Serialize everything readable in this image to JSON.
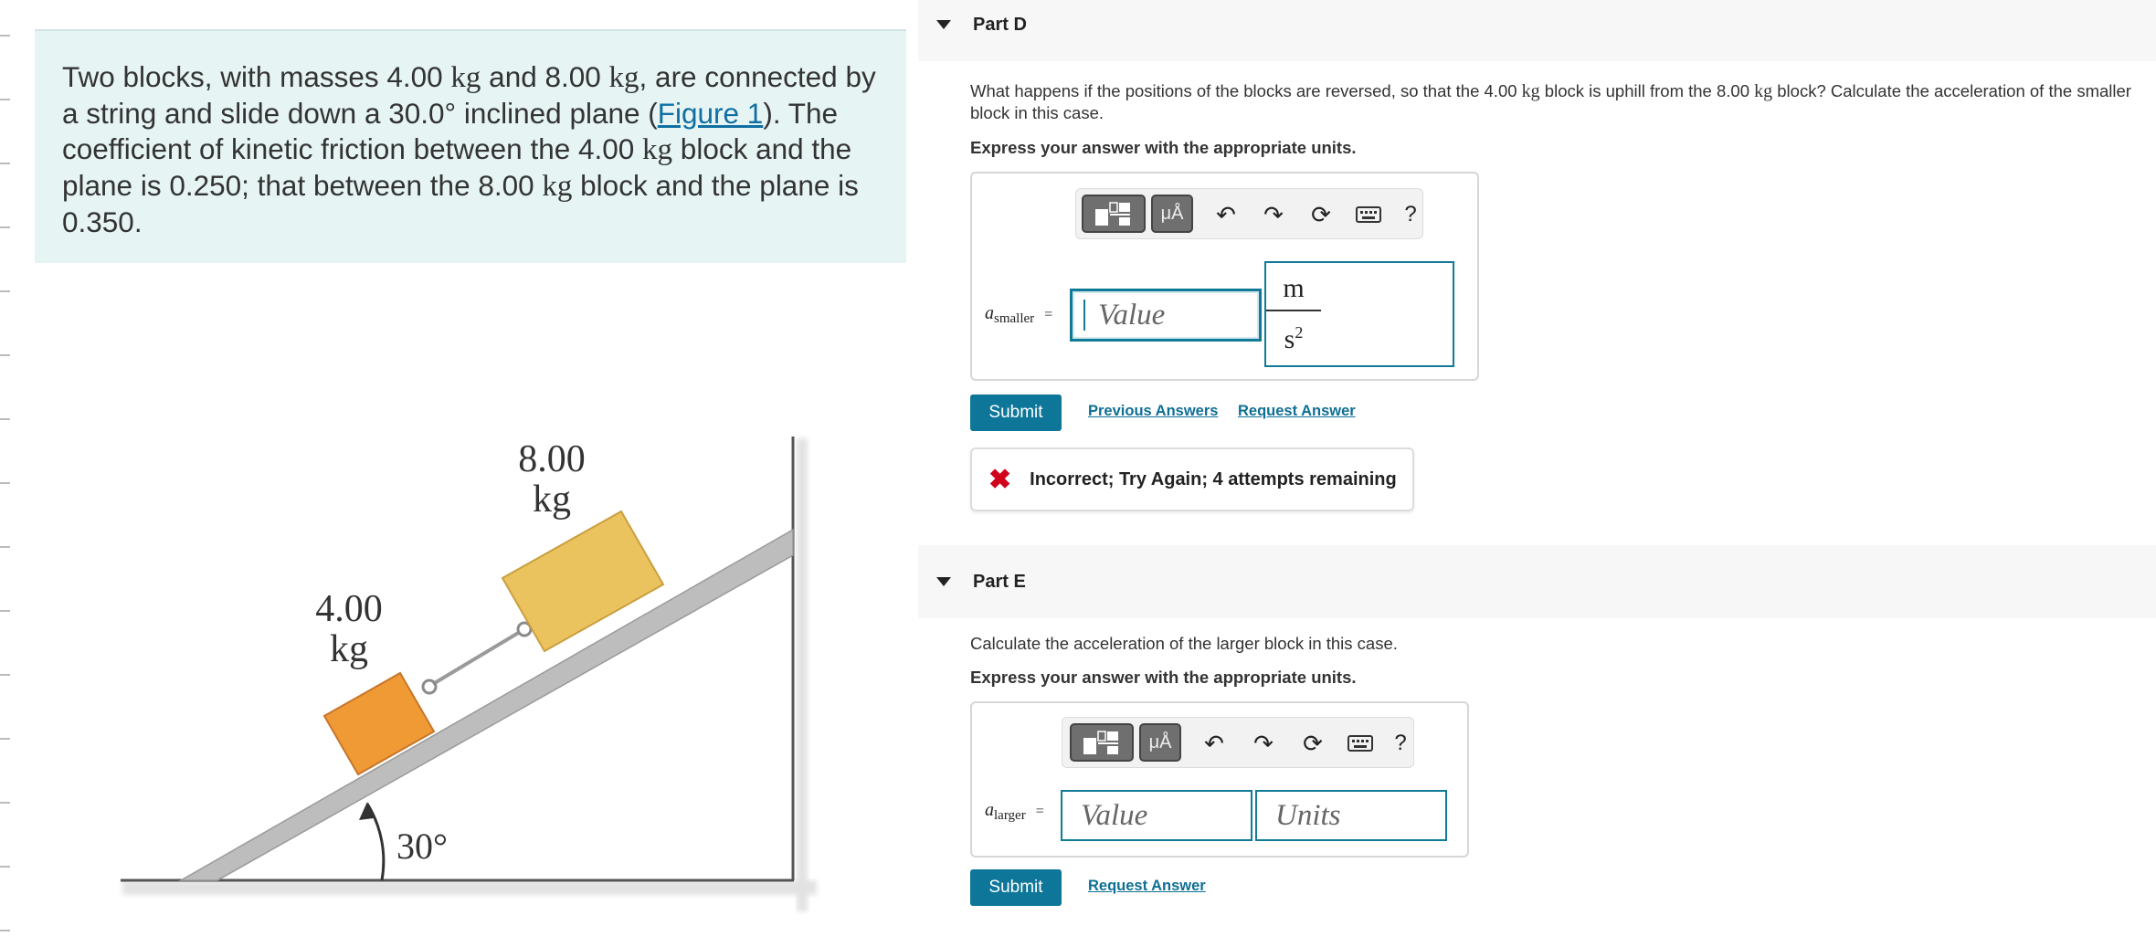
{
  "problem": {
    "p1": "Two blocks, with masses 4.00 ",
    "unit": "kg",
    "p2": " and 8.00 ",
    "p3": ", are connected by a string and slide down a 30.0° inclined plane (",
    "figure_link": "Figure 1",
    "p4": "). The coefficient of kinetic friction between the 4.00 ",
    "p5": " block and the plane is 0.250; that between the 8.00 ",
    "p6": " block and the plane is 0.350."
  },
  "figure": {
    "small_mass": "4.00",
    "large_mass": "8.00",
    "mass_unit": "kg",
    "angle": "30°",
    "colors": {
      "small_block": "#ef9a35",
      "large_block": "#ebc35e",
      "plane": "#bdbdbd"
    }
  },
  "toolbar": {
    "templates_icon": "templates-icon",
    "units_label": "μÅ",
    "undo_icon": "undo-icon",
    "redo_icon": "redo-icon",
    "reset_icon": "reset-icon",
    "keyboard_icon": "keyboard-icon",
    "help_label": "?"
  },
  "partD": {
    "title": "Part D",
    "q1": "What happens if the positions of the blocks are reversed, so that the 4.00 ",
    "unit": "kg",
    "q2": " block is uphill from the 8.00 ",
    "q3": " block? Calculate the acceleration of the smaller",
    "q4": "block in this case.",
    "instruction": "Express your answer with the appropriate units.",
    "var": "a",
    "var_sub": "smaller",
    "equals": "=",
    "value_placeholder": "Value",
    "unit_num": "m",
    "unit_den": "s",
    "unit_den_exp": "2",
    "submit": "Submit",
    "previous_answers": "Previous Answers",
    "request_answer": "Request Answer",
    "feedback": "Incorrect; Try Again; 4 attempts remaining",
    "feedback_icon": "✖"
  },
  "partE": {
    "title": "Part E",
    "question": "Calculate the acceleration of the larger block in this case.",
    "instruction": "Express your answer with the appropriate units.",
    "var": "a",
    "var_sub": "larger",
    "equals": "=",
    "value_placeholder": "Value",
    "units_placeholder": "Units",
    "submit": "Submit",
    "request_answer": "Request Answer"
  }
}
